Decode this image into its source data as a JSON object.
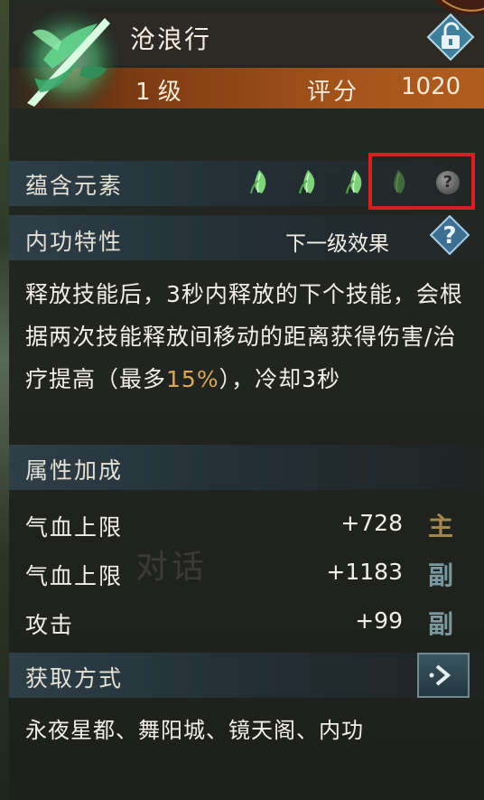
{
  "item": {
    "name": "沧浪行",
    "level": "1 级",
    "score_label": "评分",
    "score_value": "1020"
  },
  "elements": {
    "label": "蕴含元素",
    "leaves": [
      {
        "icon": "green-leaf-icon",
        "filled": true
      },
      {
        "icon": "green-leaf-icon",
        "filled": true
      },
      {
        "icon": "green-leaf-icon",
        "filled": true
      },
      {
        "icon": "dark-leaf-icon",
        "filled": false
      }
    ],
    "help_glyph": "?"
  },
  "trait": {
    "label": "内功特性",
    "next_level_label": "下一级效果",
    "help_glyph": "?",
    "description_before": "释放技能后，3秒内释放的下个技能，会根据两次技能释放间移动的距离获得伤害/治疗提高（最多",
    "description_highlight": "15%",
    "description_after": "），冷却3秒"
  },
  "attributes": {
    "label": "属性加成",
    "rows": [
      {
        "name": "气血上限",
        "value": "+728",
        "tag": "主",
        "tag_type": "main"
      },
      {
        "name": "气血上限",
        "value": "+1183",
        "tag": "副",
        "tag_type": "sub"
      },
      {
        "name": "攻击",
        "value": "+99",
        "tag": "副",
        "tag_type": "sub"
      }
    ]
  },
  "acquire": {
    "label": "获取方式",
    "sources": "永夜星都、舞阳城、镜天阁、内功"
  },
  "background_text": "对话",
  "colors": {
    "highlight": "#d9a75a",
    "level_bar": "#a4531b",
    "leaf_green": "#7fd47a",
    "red_box": "#d32020"
  }
}
